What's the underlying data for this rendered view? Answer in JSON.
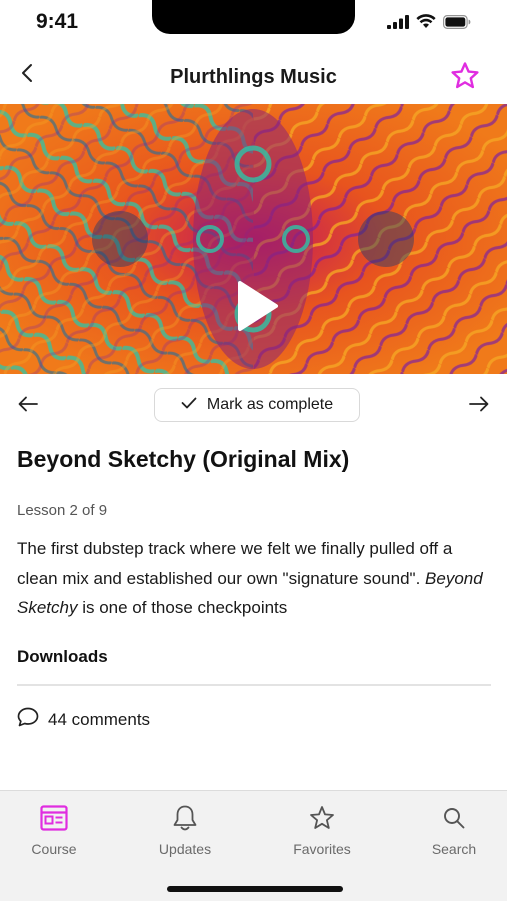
{
  "status_bar": {
    "time": "9:41"
  },
  "header": {
    "title": "Plurthlings Music",
    "back_icon": "chevron-left-icon",
    "favorite_icon": "star-outline-icon"
  },
  "video": {
    "play_icon": "play-icon"
  },
  "lesson_nav": {
    "mark_complete_label": "Mark as complete",
    "prev_icon": "arrow-left-icon",
    "next_icon": "arrow-right-icon"
  },
  "lesson": {
    "title": "Beyond Sketchy (Original Mix)",
    "count": "Lesson 2 of 9",
    "description_before": "The first dubstep track where we felt we finally pulled off a clean mix and established our own \"signature sound\". ",
    "description_italic": "Beyond Sketchy",
    "description_after": " is one of those checkpoints",
    "downloads_label": "Downloads",
    "comments_label": "44 comments"
  },
  "tabs": [
    {
      "label": "Course",
      "icon": "course-icon",
      "active": true
    },
    {
      "label": "Updates",
      "icon": "bell-icon",
      "active": false
    },
    {
      "label": "Favorites",
      "icon": "star-icon",
      "active": false
    },
    {
      "label": "Search",
      "icon": "search-icon",
      "active": false
    }
  ],
  "colors": {
    "accent": "#e02de0",
    "text": "#1a1a1a",
    "muted": "#6a6a6a",
    "tab_bar_bg": "#f2f2f2"
  }
}
